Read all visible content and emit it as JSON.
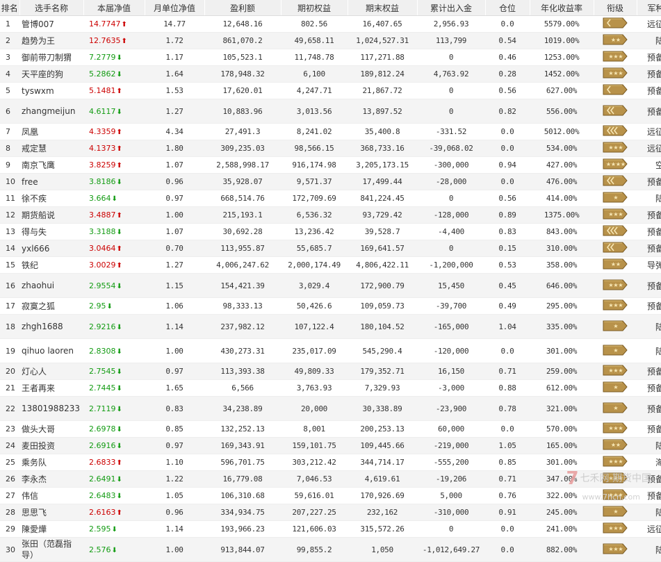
{
  "headers": [
    "排名",
    "选手名称",
    "本届净值",
    "月单位净值",
    "盈利额",
    "期初权益",
    "期末权益",
    "累计出入金",
    "仓位",
    "年化收益率",
    "衔级",
    "军种"
  ],
  "rows": [
    {
      "rank": "1",
      "name": "管博007",
      "nav": "14.7747",
      "dir": "up",
      "monthly": "14.77",
      "profit": "12,648.16",
      "start": "802.56",
      "end": "16,407.65",
      "flow": "2,956.93",
      "position": "0.0",
      "annual": "5579.00%",
      "badge": "1bar",
      "branch": "远征军"
    },
    {
      "rank": "2",
      "name": "趋势为王",
      "nav": "12.7635",
      "dir": "up",
      "monthly": "1.72",
      "profit": "861,070.2",
      "start": "49,658.11",
      "end": "1,024,527.31",
      "flow": "113,799",
      "position": "0.54",
      "annual": "1019.00%",
      "badge": "2star",
      "branch": "陆军"
    },
    {
      "rank": "3",
      "name": "御前带刀制猬",
      "nav": "7.2779",
      "dir": "down",
      "monthly": "1.17",
      "profit": "105,523.1",
      "start": "11,748.78",
      "end": "117,271.88",
      "flow": "0",
      "position": "0.46",
      "annual": "1253.00%",
      "badge": "3star",
      "branch": "预备役"
    },
    {
      "rank": "4",
      "name": "天平座的狗",
      "nav": "5.2862",
      "dir": "down",
      "monthly": "1.64",
      "profit": "178,948.32",
      "start": "6,100",
      "end": "189,812.24",
      "flow": "4,763.92",
      "position": "0.28",
      "annual": "1452.00%",
      "badge": "3star",
      "branch": "预备役"
    },
    {
      "rank": "5",
      "name": "tyswxm",
      "nav": "5.1481",
      "dir": "up",
      "monthly": "1.53",
      "profit": "17,620.01",
      "start": "4,247.71",
      "end": "21,867.72",
      "flow": "0",
      "position": "0.56",
      "annual": "627.00%",
      "badge": "1bar",
      "branch": "预备役"
    },
    {
      "rank": "6",
      "name": "zhangmeijun",
      "nav": "4.6117",
      "dir": "down",
      "monthly": "1.27",
      "profit": "10,883.96",
      "start": "3,013.56",
      "end": "13,897.52",
      "flow": "0",
      "position": "0.82",
      "annual": "556.00%",
      "badge": "2bar",
      "branch": "预备役"
    },
    {
      "rank": "7",
      "name": "凤凰",
      "nav": "4.3359",
      "dir": "up",
      "monthly": "4.34",
      "profit": "27,491.3",
      "start": "8,241.02",
      "end": "35,400.8",
      "flow": "-331.52",
      "position": "0.0",
      "annual": "5012.00%",
      "badge": "3bar",
      "branch": "远征军"
    },
    {
      "rank": "8",
      "name": "戒定慧",
      "nav": "4.1373",
      "dir": "up",
      "monthly": "1.80",
      "profit": "309,235.03",
      "start": "98,566.15",
      "end": "368,733.16",
      "flow": "-39,068.02",
      "position": "0.0",
      "annual": "534.00%",
      "badge": "3star",
      "branch": "远征军"
    },
    {
      "rank": "9",
      "name": "南京飞鹰",
      "nav": "3.8259",
      "dir": "up",
      "monthly": "1.07",
      "profit": "2,588,998.17",
      "start": "916,174.98",
      "end": "3,205,173.15",
      "flow": "-300,000",
      "position": "0.94",
      "annual": "427.00%",
      "badge": "4star",
      "branch": "空军"
    },
    {
      "rank": "10",
      "name": "free",
      "nav": "3.8186",
      "dir": "down",
      "monthly": "0.96",
      "profit": "35,928.07",
      "start": "9,571.37",
      "end": "17,499.44",
      "flow": "-28,000",
      "position": "0.0",
      "annual": "476.00%",
      "badge": "2bar",
      "branch": "预备役"
    },
    {
      "rank": "11",
      "name": "徐不疾",
      "nav": "3.664",
      "dir": "down",
      "monthly": "0.97",
      "profit": "668,514.76",
      "start": "172,709.69",
      "end": "841,224.45",
      "flow": "0",
      "position": "0.56",
      "annual": "414.00%",
      "badge": "1star",
      "branch": "陆军"
    },
    {
      "rank": "12",
      "name": "期货船说",
      "nav": "3.4887",
      "dir": "up",
      "monthly": "1.00",
      "profit": "215,193.1",
      "start": "6,536.32",
      "end": "93,729.42",
      "flow": "-128,000",
      "position": "0.89",
      "annual": "1375.00%",
      "badge": "3star",
      "branch": "预备役"
    },
    {
      "rank": "13",
      "name": "得与失",
      "nav": "3.3188",
      "dir": "down",
      "monthly": "1.07",
      "profit": "30,692.28",
      "start": "13,236.42",
      "end": "39,528.7",
      "flow": "-4,400",
      "position": "0.83",
      "annual": "843.00%",
      "badge": "3bar",
      "branch": "预备役"
    },
    {
      "rank": "14",
      "name": "yxl666",
      "nav": "3.0464",
      "dir": "up",
      "monthly": "0.70",
      "profit": "113,955.87",
      "start": "55,685.7",
      "end": "169,641.57",
      "flow": "0",
      "position": "0.15",
      "annual": "310.00%",
      "badge": "2bar",
      "branch": "预备役"
    },
    {
      "rank": "15",
      "name": "铁纪",
      "nav": "3.0029",
      "dir": "up",
      "monthly": "1.27",
      "profit": "4,006,247.62",
      "start": "2,000,174.49",
      "end": "4,806,422.11",
      "flow": "-1,200,000",
      "position": "0.53",
      "annual": "358.00%",
      "badge": "2star",
      "branch": "导弹部"
    },
    {
      "rank": "16",
      "name": "zhaohui",
      "nav": "2.9554",
      "dir": "down",
      "monthly": "1.15",
      "profit": "154,421.39",
      "start": "3,029.4",
      "end": "172,900.79",
      "flow": "15,450",
      "position": "0.45",
      "annual": "646.00%",
      "badge": "3star",
      "branch": "预备役"
    },
    {
      "rank": "17",
      "name": "寂寞之狐",
      "nav": "2.95",
      "dir": "down",
      "monthly": "1.06",
      "profit": "98,333.13",
      "start": "50,426.6",
      "end": "109,059.73",
      "flow": "-39,700",
      "position": "0.49",
      "annual": "295.00%",
      "badge": "3star",
      "branch": "预备役"
    },
    {
      "rank": "18",
      "name": "zhgh1688",
      "nav": "2.9216",
      "dir": "down",
      "monthly": "1.14",
      "profit": "237,982.12",
      "start": "107,122.4",
      "end": "180,104.52",
      "flow": "-165,000",
      "position": "1.04",
      "annual": "335.00%",
      "badge": "1star",
      "branch": "陆军"
    },
    {
      "rank": "19",
      "name": "qihuo laoren",
      "nav": "2.8308",
      "dir": "down",
      "monthly": "1.00",
      "profit": "430,273.31",
      "start": "235,017.09",
      "end": "545,290.4",
      "flow": "-120,000",
      "position": "0.0",
      "annual": "301.00%",
      "badge": "1star",
      "branch": "陆军"
    },
    {
      "rank": "20",
      "name": "灯心人",
      "nav": "2.7545",
      "dir": "down",
      "monthly": "0.97",
      "profit": "113,393.38",
      "start": "49,809.33",
      "end": "179,352.71",
      "flow": "16,150",
      "position": "0.71",
      "annual": "259.00%",
      "badge": "3star",
      "branch": "预备役"
    },
    {
      "rank": "21",
      "name": "王者再来",
      "nav": "2.7445",
      "dir": "down",
      "monthly": "1.65",
      "profit": "6,566",
      "start": "3,763.93",
      "end": "7,329.93",
      "flow": "-3,000",
      "position": "0.88",
      "annual": "612.00%",
      "badge": "1star",
      "branch": "预备役"
    },
    {
      "rank": "22",
      "name": "13801988233",
      "nav": "2.7119",
      "dir": "down",
      "monthly": "0.83",
      "profit": "34,238.89",
      "start": "20,000",
      "end": "30,338.89",
      "flow": "-23,900",
      "position": "0.78",
      "annual": "321.00%",
      "badge": "1star",
      "branch": "预备役"
    },
    {
      "rank": "23",
      "name": "做头大哥",
      "nav": "2.6978",
      "dir": "down",
      "monthly": "0.85",
      "profit": "132,252.13",
      "start": "8,001",
      "end": "200,253.13",
      "flow": "60,000",
      "position": "0.0",
      "annual": "570.00%",
      "badge": "3star",
      "branch": "预备役"
    },
    {
      "rank": "24",
      "name": "麦田投资",
      "nav": "2.6916",
      "dir": "down",
      "monthly": "0.97",
      "profit": "169,343.91",
      "start": "159,101.75",
      "end": "109,445.66",
      "flow": "-219,000",
      "position": "1.05",
      "annual": "165.00%",
      "badge": "2star",
      "branch": "陆军"
    },
    {
      "rank": "25",
      "name": "乘务队",
      "nav": "2.6833",
      "dir": "up",
      "monthly": "1.10",
      "profit": "596,701.75",
      "start": "303,212.42",
      "end": "344,714.17",
      "flow": "-555,200",
      "position": "0.85",
      "annual": "301.00%",
      "badge": "3star",
      "branch": "海军"
    },
    {
      "rank": "26",
      "name": "李永杰",
      "nav": "2.6491",
      "dir": "down",
      "monthly": "1.22",
      "profit": "16,779.08",
      "start": "7,046.53",
      "end": "4,619.61",
      "flow": "-19,206",
      "position": "0.71",
      "annual": "347.00%",
      "badge": "3star",
      "branch": "预备役"
    },
    {
      "rank": "27",
      "name": "伟信",
      "nav": "2.6483",
      "dir": "down",
      "monthly": "1.05",
      "profit": "106,310.68",
      "start": "59,616.01",
      "end": "170,926.69",
      "flow": "5,000",
      "position": "0.76",
      "annual": "322.00%",
      "badge": "3star",
      "branch": "预备役"
    },
    {
      "rank": "28",
      "name": "思思飞",
      "nav": "2.6163",
      "dir": "up",
      "monthly": "0.96",
      "profit": "334,934.75",
      "start": "207,227.25",
      "end": "232,162",
      "flow": "-310,000",
      "position": "0.91",
      "annual": "245.00%",
      "badge": "1star",
      "branch": "陆军"
    },
    {
      "rank": "29",
      "name": "陳愛燁",
      "nav": "2.595",
      "dir": "down",
      "monthly": "1.14",
      "profit": "193,966.23",
      "start": "121,606.03",
      "end": "315,572.26",
      "flow": "0",
      "position": "0.0",
      "annual": "241.00%",
      "badge": "3star",
      "branch": "远征军"
    },
    {
      "rank": "30",
      "name": "张田（范磊指导）",
      "nav": "2.576",
      "dir": "down",
      "monthly": "1.00",
      "profit": "913,844.07",
      "start": "99,855.2",
      "end": "1,050",
      "flow": "-1,012,649.27",
      "position": "0.0",
      "annual": "882.00%",
      "badge": "3star",
      "branch": "陆军"
    }
  ],
  "watermark": {
    "text": "七禾网·期货中国",
    "sub": "www.7hcn.com"
  },
  "colors": {
    "up": "#cc0000",
    "down": "#129b12",
    "badge_fill": "#b8924a",
    "badge_stroke": "#7a5a22"
  }
}
